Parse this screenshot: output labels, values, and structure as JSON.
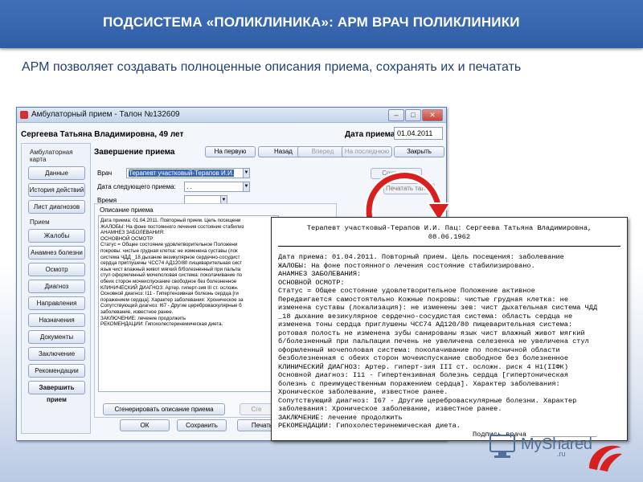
{
  "slide": {
    "title": "ПОДСИСТЕМА «ПОЛИКЛИНИКА»: АРМ ВРАЧ ПОЛИКЛИНИКИ",
    "lead": "АРМ позволяет создавать полноценные описания приема, сохранять их и печатать",
    "logo": "MyShared",
    "logo_sub": ".ru"
  },
  "window": {
    "title": "Амбулаторный прием - Талон №132609",
    "patient": "Сергеева Татьяна Владимировна, 49 лет",
    "date_label": "Дата приема",
    "date_value": "01.04.2011",
    "sidebar": {
      "group1": "Амбулаторная карта",
      "group1_items": [
        "Данные",
        "История действий",
        "Лист диагнозов"
      ],
      "group2": "Прием",
      "group2_items": [
        "Жалобы",
        "Анамнез болезни",
        "Осмотр",
        "Диагноз",
        "Направления",
        "Назначения",
        "Документы",
        "Заключение",
        "Рекомендации"
      ],
      "finish": "Завершить прием"
    },
    "main": {
      "section": "Завершение приема",
      "toolbar": [
        "На первую",
        "Назад",
        "Вперед",
        "На последнюю",
        "Закрыть"
      ],
      "doctor_label": "Врач",
      "doctor_value": "Терапевт участковый-Терапов И.И.",
      "next_date_label": "Дата следующего приема:",
      "next_date_value": ". .",
      "time_label": "Время",
      "save_partial": "Сохранит",
      "print_ticket": "Печатать талон",
      "desc_label": "Описание приема",
      "desc_lines": [
        "Дата приема: 01.04.2011. Повторный прием. Цель посещени",
        "ЖАЛОБЫ: На фоне постоянного лечения состояние стабилиз",
        "АНАМНЕЗ ЗАБОЛЕВАНИЯ:",
        "ОСНОВНОЙ ОСМОТР:",
        "  Статус = Общее состояние удовлетворительное Положени",
        "покровы: чистые грудная клетка: не изменена суставы (лок",
        "система ЧДД _18 дыхание везикулярное сердечно-сосудист",
        "сердца приглушены ЧСС74 АД120/80 пищеварительная сист",
        "язык чист влажный живот мягкий б/болезненный при пальпа",
        "стул оформленный мочеполовая система: поколачивание по",
        "обеих сторон мочеиспускание свободное без болезненное",
        "КЛИНИЧЕСКИЙ ДИАГНОЗ: Артер. гиперт-зия III ст. осложн. ",
        "Основной диагноз: I11 - Гипертензивная болезнь сердца [ги",
        "поражением сердца]. Характер заболевания: Хроническое за",
        "Сопутствующий диагноз: I67 - Другие цереброваскулярные б",
        "заболевание, известное ранее.",
        "ЗАКЛЮЧЕНИЕ: лечение продолжить",
        "РЕКОМЕНДАЦИИ: Гипохолестеринемическая диета."
      ],
      "generate": "Сгенерировать описание приема",
      "generate2": "Сге",
      "bottom": [
        "ОК",
        "Сохранить",
        "Печать"
      ]
    }
  },
  "printout": {
    "header1": "Терапевт участковый-Терапов И.И. Пац: Сергеева Татьяна Владимировна,",
    "header2": "08.06.1962",
    "lines": [
      "Дата приема: 01.04.2011. Повторный прием. Цель посещения: заболевание",
      "ЖАЛОБЫ: На фоне постоянного лечения состояние стабилизировано.",
      "АНАМНЕЗ ЗАБОЛЕВАНИЯ:",
      "ОСНОВНОЙ ОСМОТР:",
      "  Статус =  Общее состояние удовлетворительное Положение активное",
      "Передвигается самостоятельно Кожные покровы: чистые грудная клетка: не",
      "изменена суставы (локализация): не изменены зев: чист дыхательная система ЧДД",
      "_18 дыхание везикулярное сердечно-сосудистая система: область сердца не",
      "изменена тоны сердца  приглушены ЧСС74 АД120/80 пищеварительная система:",
      "ротовая полость не изменена зубы санированы язык чист влажный живот мягкий",
      "б/болезненный при пальпации печень не увеличена селезенка не увеличена стул",
      "оформленный мочеполовая система: поколачивание по поясничной области",
      "безболезненная с обеих сторон мочеиспускание свободное без болезненное",
      "КЛИНИЧЕСКИЙ ДИАГНОЗ: Артер. гиперт-зия III ст. осложн. риск 4 Н1(IIФК)",
      "Основной диагноз: I11 - Гипертензивная болезнь сердца [гипертоническая",
      "болезнь с преимущественным поражением сердца]. Характер заболевания:",
      "Хроническое заболевание, известное ранее.",
      "Сопутствующий диагноз: I67 - Другие цереброваскулярные болезни. Характер",
      "заболевания: Хроническое заболевание, известное ранее.",
      "ЗАКЛЮЧЕНИЕ: лечение продолжить",
      "РЕКОМЕНДАЦИИ: Гипохолестеринемическая диета."
    ],
    "signature": "Подпись врача ________________"
  },
  "colors": {
    "header_bg": "#3566b0",
    "arrow": "#d8201f"
  },
  "icons": [
    "app-icon",
    "minimize-icon",
    "maximize-icon",
    "close-icon",
    "curved-arrow-icon",
    "logo-icon"
  ]
}
